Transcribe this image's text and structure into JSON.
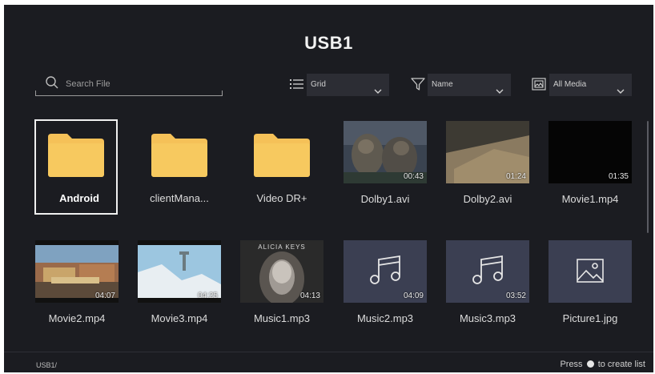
{
  "header": {
    "title": "USB1"
  },
  "search": {
    "placeholder": "Search File",
    "icon": "search-icon"
  },
  "toolbar": {
    "view": {
      "icon": "list-icon",
      "value": "Grid"
    },
    "sort": {
      "icon": "filter-icon",
      "value": "Name"
    },
    "media": {
      "icon": "gallery-icon",
      "value": "All Media"
    }
  },
  "files": [
    {
      "name": "Android",
      "type": "folder"
    },
    {
      "name": "clientMana...",
      "type": "folder"
    },
    {
      "name": "Video DR+",
      "type": "folder"
    },
    {
      "name": "Dolby1.avi",
      "type": "video",
      "duration": "00:43"
    },
    {
      "name": "Dolby2.avi",
      "type": "video",
      "duration": "01:24"
    },
    {
      "name": "Movie1.mp4",
      "type": "video",
      "duration": "01:35"
    },
    {
      "name": "Movie2.mp4",
      "type": "video",
      "duration": "04:07"
    },
    {
      "name": "Movie3.mp4",
      "type": "video",
      "duration": "04:25"
    },
    {
      "name": "Music1.mp3",
      "type": "audio",
      "duration": "04:13",
      "album_text": "ALICIA KEYS"
    },
    {
      "name": "Music2.mp3",
      "type": "audio",
      "duration": "04:09"
    },
    {
      "name": "Music3.mp3",
      "type": "audio",
      "duration": "03:52"
    },
    {
      "name": "Picture1.jpg",
      "type": "image"
    }
  ],
  "footer": {
    "path": "USB1/",
    "hint_prefix": "Press",
    "hint_suffix": "to create list"
  },
  "colors": {
    "background": "#1b1c21",
    "folder": "#f5c158",
    "tile": "#3b3f52",
    "focus": "#f0f0f0"
  }
}
